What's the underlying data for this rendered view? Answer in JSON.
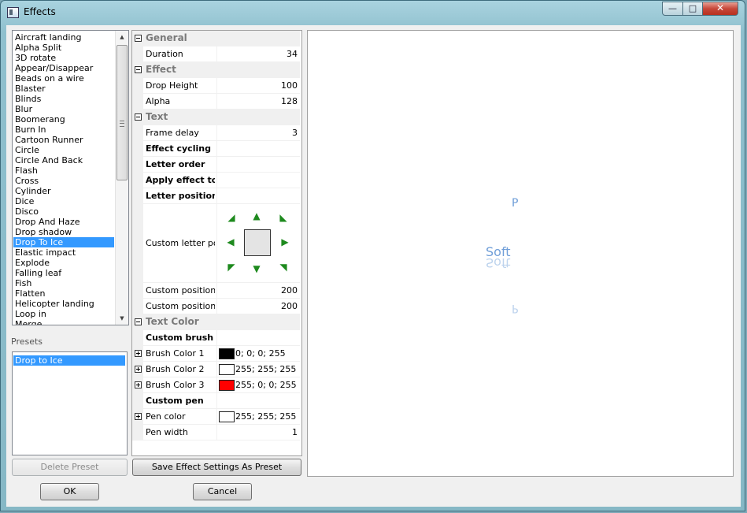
{
  "window": {
    "title": "Effects"
  },
  "effects": {
    "items": [
      "Aircraft landing",
      "Alpha Split",
      "3D rotate",
      "Appear/Disappear",
      "Beads on a wire",
      "Blaster",
      "Blinds",
      "Blur",
      "Boomerang",
      "Burn In",
      "Cartoon Runner",
      "Circle",
      "Circle And Back",
      "Flash",
      "Cross",
      "Cylinder",
      "Dice",
      "Disco",
      "Drop And Haze",
      "Drop shadow",
      "Drop To Ice",
      "Elastic impact",
      "Explode",
      "Falling leaf",
      "Fish",
      "Flatten",
      "Helicopter landing",
      "Loop in",
      "Merge"
    ],
    "selected": "Drop To Ice"
  },
  "presets": {
    "label": "Presets",
    "items": [
      "Drop to Ice"
    ]
  },
  "properties": {
    "general": {
      "label": "General",
      "duration_label": "Duration",
      "duration_value": "34"
    },
    "effect": {
      "label": "Effect",
      "drop_height_label": "Drop Height",
      "drop_height_value": "100",
      "alpha_label": "Alpha",
      "alpha_value": "128"
    },
    "text": {
      "label": "Text",
      "frame_delay_label": "Frame delay",
      "frame_delay_value": "3",
      "effect_cycling_label": "Effect cycling",
      "letter_order_label": "Letter order",
      "apply_effect_label": "Apply effect to",
      "letter_position_label": "Letter position",
      "custom_letter_label": "Custom letter position",
      "custom_position_1_label": "Custom position X",
      "custom_position_1_value": "200",
      "custom_position_2_label": "Custom position Y",
      "custom_position_2_value": "200"
    },
    "text_color": {
      "label": "Text Color",
      "custom_brush_label": "Custom brush",
      "brush1_label": "Brush Color 1",
      "brush1_value": "0; 0; 0; 255",
      "brush1_color": "#000000",
      "brush2_label": "Brush Color 2",
      "brush2_value": "255; 255; 255",
      "brush2_color": "#ffffff",
      "brush3_label": "Brush Color 3",
      "brush3_value": "255; 0; 0; 255",
      "brush3_color": "#ff0000",
      "custom_pen_label": "Custom pen",
      "pen_color_label": "Pen color",
      "pen_color_value": "255; 255; 255",
      "pen_color_color": "#ffffff",
      "pen_width_label": "Pen width",
      "pen_width_value": "1"
    }
  },
  "preview": {
    "letter_top": "P",
    "word": "Soft",
    "letter_bottom": "P",
    "text_color": "#6f9ed8"
  },
  "buttons": {
    "delete_preset": "Delete Preset",
    "save_preset": "Save Effect Settings As Preset",
    "ok": "OK",
    "cancel": "Cancel"
  }
}
